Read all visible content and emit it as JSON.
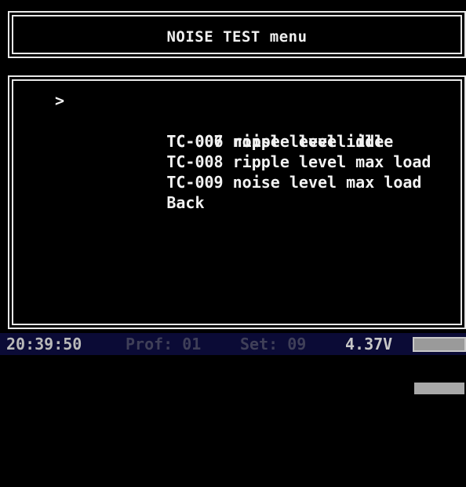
{
  "header": {
    "title": "NOISE TEST menu"
  },
  "menu": {
    "cursor": ">",
    "items": [
      {
        "label": "TC-006 noise level idle",
        "selected": true
      },
      {
        "label": "TC-007 ripple level idle",
        "selected": false
      },
      {
        "label": "TC-008 ripple level max load",
        "selected": false
      },
      {
        "label": "TC-009 noise level max load",
        "selected": false
      },
      {
        "label": "Back",
        "selected": false
      }
    ]
  },
  "status": {
    "time": "20:39:50",
    "prof": "Prof: 01",
    "set": "Set: 09",
    "voltage": "4.37V"
  }
}
